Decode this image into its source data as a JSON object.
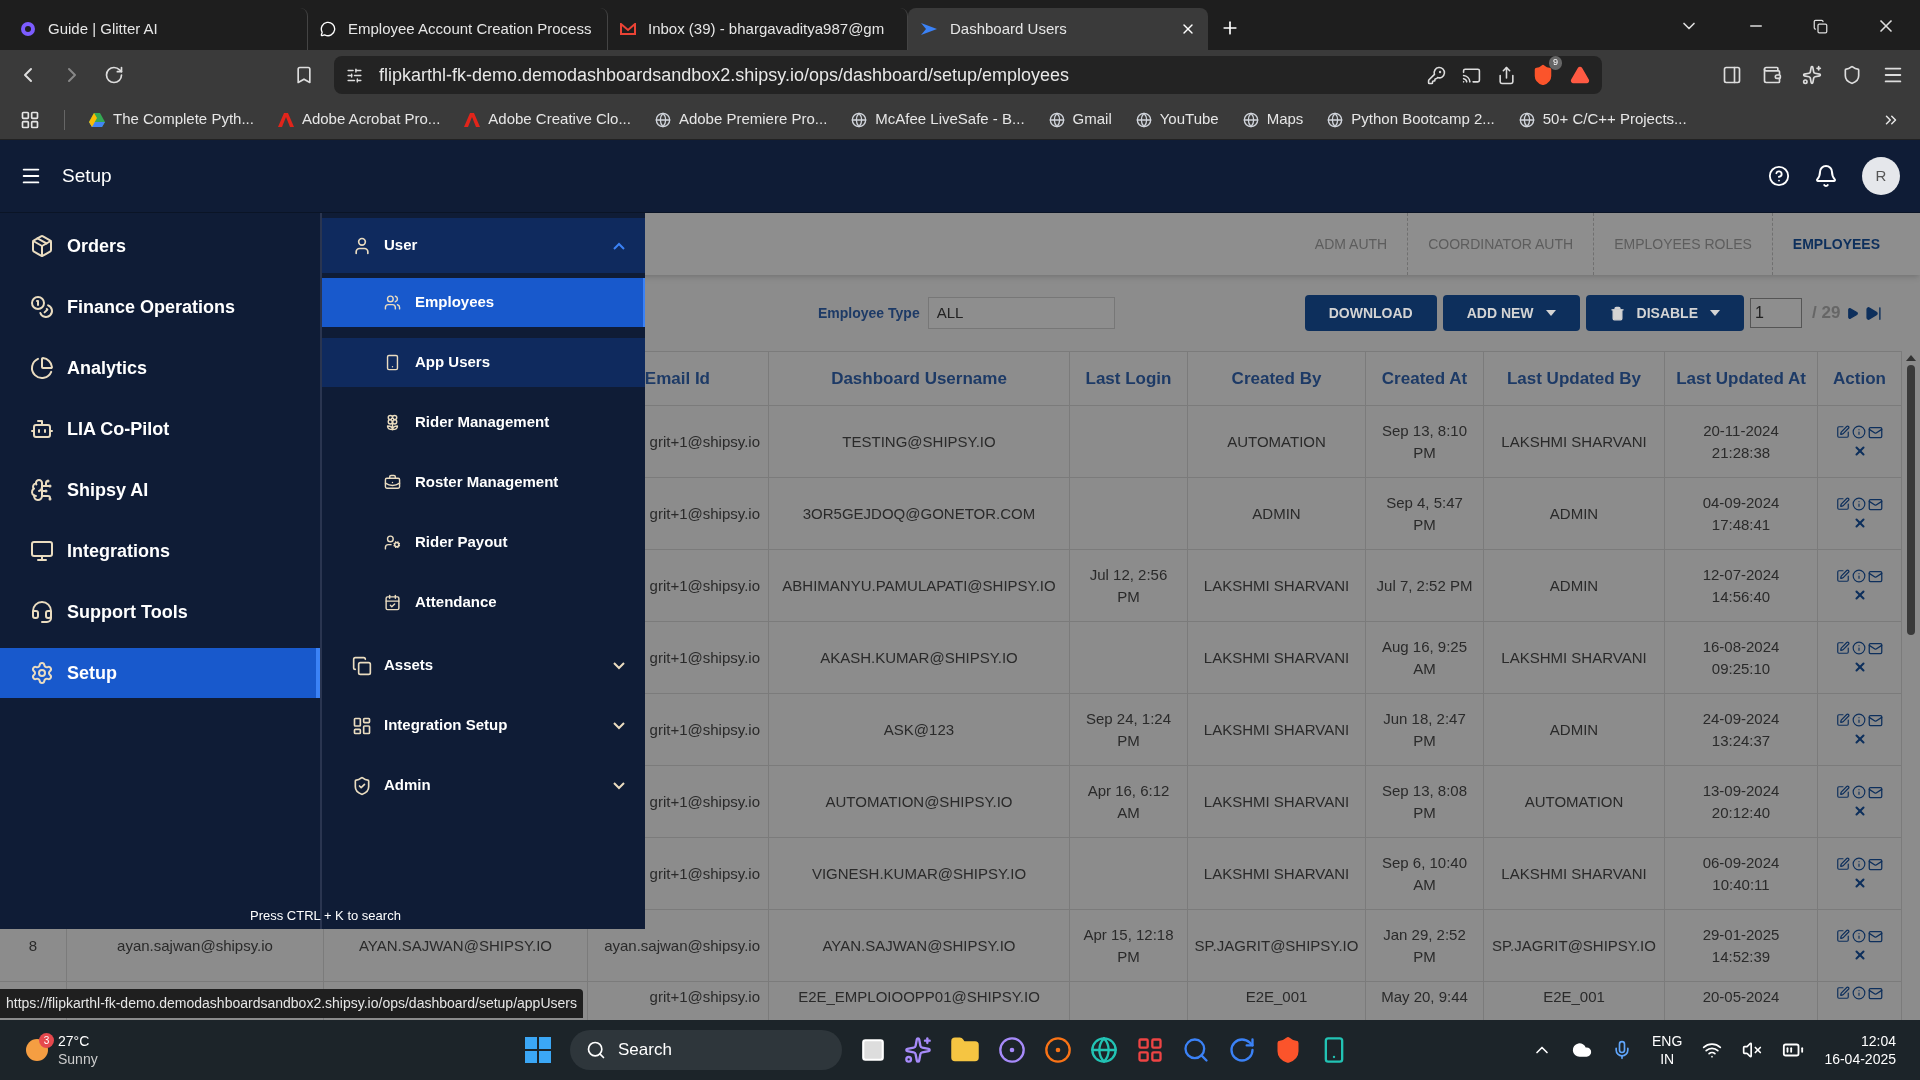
{
  "browser": {
    "tabs": [
      {
        "title": "Guide | Glitter AI",
        "selected": false
      },
      {
        "title": "Employee Account Creation Process",
        "selected": false
      },
      {
        "title": "Inbox (39) - bhargavaditya987@gm",
        "selected": false
      },
      {
        "title": "Dashboard Users",
        "selected": true
      }
    ],
    "url": "flipkarthl-fk-demo.demodashboardsandbox2.shipsy.io/ops/dashboard/setup/employees",
    "shields_badge": "9",
    "bookmarks": [
      {
        "label": "The Complete Pyth..."
      },
      {
        "label": "Adobe Acrobat Pro..."
      },
      {
        "label": "Adobe Creative Clo..."
      },
      {
        "label": "Adobe Premiere Pro..."
      },
      {
        "label": "McAfee LiveSafe - B..."
      },
      {
        "label": "Gmail"
      },
      {
        "label": "YouTube"
      },
      {
        "label": "Maps"
      },
      {
        "label": "Python Bootcamp 2..."
      },
      {
        "label": "50+ C/C++ Projects..."
      }
    ]
  },
  "header": {
    "title": "Setup",
    "avatar": "R"
  },
  "sidebar": {
    "items": [
      {
        "label": "Orders",
        "selected": false
      },
      {
        "label": "Finance Operations",
        "selected": false
      },
      {
        "label": "Analytics",
        "selected": false
      },
      {
        "label": "LIA Co-Pilot",
        "selected": false
      },
      {
        "label": "Shipsy AI",
        "selected": false
      },
      {
        "label": "Integrations",
        "selected": false
      },
      {
        "label": "Support Tools",
        "selected": false
      },
      {
        "label": "Setup",
        "selected": true
      }
    ],
    "submenu": [
      {
        "label": "User",
        "expanded": true,
        "children": [
          {
            "label": "Employees",
            "selected": true
          },
          {
            "label": "App Users",
            "selected": false,
            "hovered": true
          },
          {
            "label": "Rider Management",
            "selected": false,
            "hovered": false
          },
          {
            "label": "Roster Management",
            "selected": false,
            "hovered": false
          },
          {
            "label": "Rider Payout",
            "selected": false,
            "hovered": false
          },
          {
            "label": "Attendance",
            "selected": false,
            "hovered": false
          }
        ]
      },
      {
        "label": "Assets",
        "expanded": false
      },
      {
        "label": "Integration Setup",
        "expanded": false
      },
      {
        "label": "Admin",
        "expanded": false
      }
    ],
    "hint": "Press CTRL + K to search"
  },
  "subtabs": [
    {
      "label": "ADM AUTH",
      "selected": false
    },
    {
      "label": "COORDINATOR AUTH",
      "selected": false
    },
    {
      "label": "EMPLOYEES ROLES",
      "selected": false
    },
    {
      "label": "EMPLOYEES",
      "selected": true
    }
  ],
  "toolbar": {
    "filter_label": "Employee Type",
    "filter_value": "ALL",
    "buttons": [
      {
        "label": "DOWNLOAD",
        "kind": "plain"
      },
      {
        "label": "ADD NEW",
        "kind": "menu"
      },
      {
        "label": "DISABLE",
        "kind": "trash-menu"
      }
    ],
    "page": "1",
    "page_total": "/ 29"
  },
  "table": {
    "columns": [
      "Email Id",
      "Dashboard Username",
      "Last Login",
      "Created By",
      "Created At",
      "Last Updated By",
      "Last Updated At",
      "Action"
    ],
    "rows": [
      {
        "email": "grit+1@shipsy.io",
        "username": "TESTING@SHIPSY.IO",
        "created_by": "AUTOMATION",
        "created_at": "Sep 13, 8:10 PM",
        "updated_by": "LAKSHMI SHARVANI",
        "updated_at": "20-11-2024 21:28:38"
      },
      {
        "email": "grit+1@shipsy.io",
        "username": "3OR5GEJDOQ@GONETOR.COM",
        "created_by": "ADMIN",
        "created_at": "Sep 4, 5:47 PM",
        "updated_by": "ADMIN",
        "updated_at": "04-09-2024 17:48:41"
      },
      {
        "email": "grit+1@shipsy.io",
        "username": "ABHIMANYU.PAMULAPATI@SHIPSY.IO",
        "last_login": "Jul 12, 2:56 PM",
        "created_by": "LAKSHMI SHARVANI",
        "created_at": "Jul 7, 2:52 PM",
        "updated_by": "ADMIN",
        "updated_at": "12-07-2024 14:56:40"
      },
      {
        "email": "grit+1@shipsy.io",
        "username": "AKASH.KUMAR@SHIPSY.IO",
        "created_by": "LAKSHMI SHARVANI",
        "created_at": "Aug 16, 9:25 AM",
        "updated_by": "LAKSHMI SHARVANI",
        "updated_at": "16-08-2024 09:25:10"
      },
      {
        "email": "grit+1@shipsy.io",
        "username": "ASK@123",
        "last_login": "Sep 24, 1:24 PM",
        "created_by": "LAKSHMI SHARVANI",
        "created_at": "Jun 18, 2:47 PM",
        "updated_by": "ADMIN",
        "updated_at": "24-09-2024 13:24:37"
      },
      {
        "email": "grit+1@shipsy.io",
        "username": "AUTOMATION@SHIPSY.IO",
        "last_login": "Apr 16, 6:12 AM",
        "created_by": "LAKSHMI SHARVANI",
        "created_at": "Sep 13, 8:08 PM",
        "updated_by": "AUTOMATION",
        "updated_at": "13-09-2024 20:12:40"
      },
      {
        "email": "grit+1@shipsy.io",
        "username": "VIGNESH.KUMAR@SHIPSY.IO",
        "created_by": "LAKSHMI SHARVANI",
        "created_at": "Sep 6, 10:40 AM",
        "updated_by": "LAKSHMI SHARVANI",
        "updated_at": "06-09-2024 10:40:11"
      },
      {
        "column_1": "8",
        "column_2": "ayan.sajwan@shipsy.io",
        "column_3": "AYAN.SAJWAN@SHIPSY.IO",
        "email": "ayan.sajwan@shipsy.io",
        "username": "AYAN.SAJWAN@SHIPSY.IO",
        "last_login": "Apr 15, 12:18 PM",
        "created_by": "SP.JAGRIT@SHIPSY.IO",
        "created_at": "Jan 29, 2:52 PM",
        "updated_by": "SP.JAGRIT@SHIPSY.IO",
        "updated_at": "29-01-2025 14:52:39"
      },
      {
        "email": "grit+1@shipsy.io",
        "username": "E2E_EMPLOIOOPP01@SHIPSY.IO",
        "created_by": "E2E_001",
        "created_at": "May 20, 9:44",
        "updated_by": "E2E_001",
        "updated_at": "20-05-2024"
      }
    ]
  },
  "status_url": "https://flipkarthl-fk-demo.demodashboardsandbox2.shipsy.io/ops/dashboard/setup/appUsers",
  "taskbar": {
    "weather_badge": "3",
    "temperature": "27°C",
    "condition": "Sunny",
    "search": "Search",
    "language": "ENG",
    "region": "IN",
    "time": "12:04",
    "date": "16-04-2025"
  }
}
